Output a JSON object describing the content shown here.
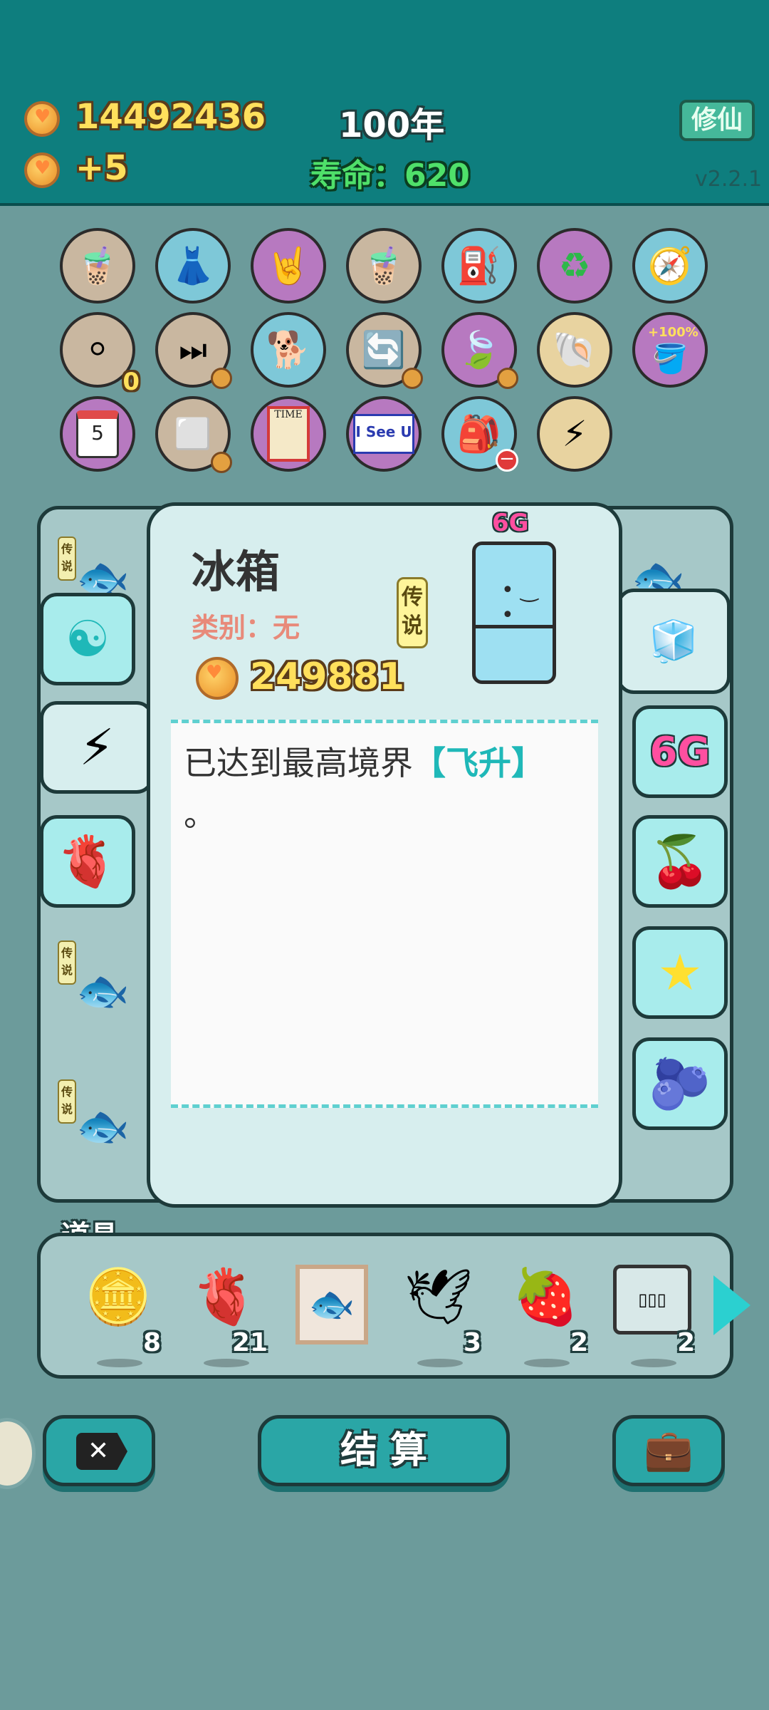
{
  "header": {
    "coins": "14492436",
    "income": "+5",
    "year": "100年",
    "lifespan_label": "寿命：",
    "lifespan_value": "620",
    "cultivate_button": "修仙",
    "version": "v2.2.1"
  },
  "upgrades": {
    "count_badge": "0",
    "calendar_day": "5",
    "time_label": "TIME",
    "isee_label": "I See U",
    "bucket_label": "+100%"
  },
  "dialog": {
    "title": "冰箱",
    "category": "类别：无",
    "price": "249881",
    "rarity": "传说",
    "item_tag": "6G",
    "description_text": "已达到最高境界",
    "description_highlight": "【飞升】",
    "description_end": "。"
  },
  "tabs_right": {
    "tag_6g": "6G",
    "small_tag": "6G"
  },
  "bg_tags": [
    "传说",
    "传说",
    "传说",
    "传说"
  ],
  "items_panel": {
    "title": "道具",
    "items": [
      {
        "icon": "coin-dollar-icon",
        "count": "8"
      },
      {
        "icon": "liver-icon",
        "count": "21"
      },
      {
        "icon": "framed-fish-icon",
        "count": ""
      },
      {
        "icon": "pigeon-icon",
        "count": "3"
      },
      {
        "icon": "strawberry-icon",
        "count": "2"
      },
      {
        "icon": "cabinet-icon",
        "count": "2"
      }
    ]
  },
  "bottom_bar": {
    "settle_label": "结 算"
  },
  "colors": {
    "teal": "#0e7e7e",
    "yellow_text": "#ffe05c",
    "green_text": "#4fe06a",
    "highlight": "#1fb8b8"
  }
}
